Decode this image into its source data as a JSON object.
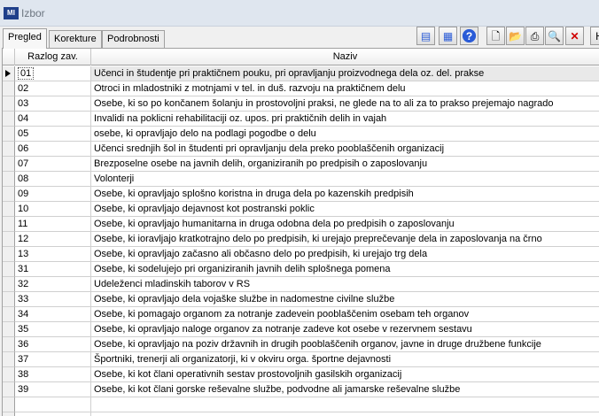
{
  "window": {
    "title": "Izbor",
    "app_icon_text": "MI"
  },
  "tabs": [
    {
      "label": "Pregled",
      "active": true
    },
    {
      "label": "Korekture",
      "active": false
    },
    {
      "label": "Podrobnosti",
      "active": false
    }
  ],
  "toolbar": {
    "buttons": [
      {
        "name": "text-view-icon",
        "glyph": "▤"
      },
      {
        "name": "grid-view-icon",
        "glyph": "▦"
      },
      {
        "name": "help-icon",
        "glyph": "?"
      },
      {
        "name": "new-document-icon",
        "glyph": "🗋"
      },
      {
        "name": "open-folder-icon",
        "glyph": "📂"
      },
      {
        "name": "print-icon",
        "glyph": "⎙"
      },
      {
        "name": "search-icon",
        "glyph": "🔍"
      },
      {
        "name": "close-icon",
        "glyph": "✕"
      },
      {
        "name": "overflow-button",
        "glyph": "H"
      }
    ]
  },
  "grid": {
    "columns": [
      "Razlog zav.",
      "Naziv"
    ],
    "selected_index": 0,
    "rows": [
      {
        "code": "01",
        "name": "Učenci in študentje pri praktičnem pouku, pri opravljanju proizvodnega dela oz. del. prakse"
      },
      {
        "code": "02",
        "name": "Otroci in mladostniki z motnjami v tel. in duš. razvoju na praktičnem delu"
      },
      {
        "code": "03",
        "name": "Osebe, ki so po končanem šolanju in prostovoljni praksi, ne glede na to ali za to prakso prejemajo nagrado"
      },
      {
        "code": "04",
        "name": "Invalidi na poklicni rehabilitaciji oz. upos. pri praktičnih delih in vajah"
      },
      {
        "code": "05",
        "name": "osebe, ki opravljajo delo na podlagi pogodbe o delu"
      },
      {
        "code": "06",
        "name": "Učenci srednjih šol in študenti pri opravljanju dela preko pooblaščenih organizacij"
      },
      {
        "code": "07",
        "name": "Brezposelne osebe na javnih delih, organiziranih po predpisih o zaposlovanju"
      },
      {
        "code": "08",
        "name": "Volonterji"
      },
      {
        "code": "09",
        "name": "Osebe, ki opravljajo splošno koristna in druga dela po kazenskih predpisih"
      },
      {
        "code": "10",
        "name": "Osebe, ki opravljajo dejavnost kot postranski poklic"
      },
      {
        "code": "11",
        "name": "Osebe, ki opravljajo humanitarna in druga odobna dela po predpisih o zaposlovanju"
      },
      {
        "code": "12",
        "name": "Osebe, ki ioravljajo kratkotrajno delo po predpisih, ki urejajo preprečevanje dela in zaposlovanja na črno"
      },
      {
        "code": "13",
        "name": "Osebe, ki opravljajo začasno ali občasno delo po predpisih, ki urejajo trg dela"
      },
      {
        "code": "31",
        "name": "Osebe, ki sodelujejo pri organiziranih javnih delih splošnega pomena"
      },
      {
        "code": "32",
        "name": "Udeleženci mladinskih taborov v RS"
      },
      {
        "code": "33",
        "name": "Osebe, ki opravljajo dela vojaške službe in nadomestne civilne službe"
      },
      {
        "code": "34",
        "name": "Osebe, ki pomagajo organom za notranje zadevein pooblaščenim osebam teh organov"
      },
      {
        "code": "35",
        "name": "Osebe, ki opravljajo naloge organov za notranje zadeve kot osebe v rezervnem sestavu"
      },
      {
        "code": "36",
        "name": "Osebe, ki opravljajo na poziv državnih in drugih pooblaščenih organov, javne in druge družbene funkcije"
      },
      {
        "code": "37",
        "name": "Športniki, trenerji ali organizatorji, ki v okviru orga. športne dejavnosti"
      },
      {
        "code": "38",
        "name": "Osebe, ki kot člani operativnih sestav prostovoljnih gasilskih organizacij"
      },
      {
        "code": "39",
        "name": "Osebe, ki kot člani gorske reševalne službe, podvodne ali jamarske reševalne službe"
      }
    ]
  }
}
